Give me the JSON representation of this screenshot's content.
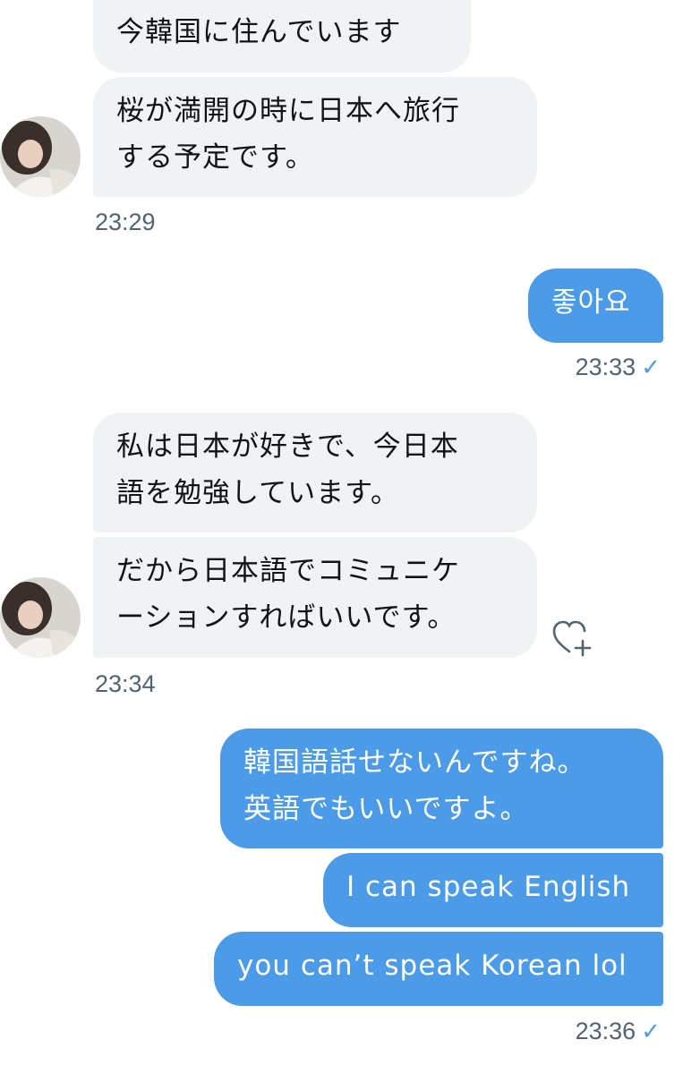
{
  "messages": {
    "m1": "今韓国に住んでいます",
    "m2": "桜が満開の時に日本へ旅行\nする予定です。",
    "t1": "23:29",
    "m3": "좋아요",
    "t2": "23:33",
    "m4": "私は日本が好きで、今日本\n語を勉強しています。",
    "m5": "だから日本語でコミュニケ\nーションすればいいです。",
    "t3": "23:34",
    "m6": "韓国語話せないんですね。\n英語でもいいですよ。",
    "m7": "I can speak English",
    "m8": "you can’t speak Korean lol",
    "t4": "23:36"
  },
  "icons": {
    "read_receipt": "checkmark-icon",
    "react": "heart-plus-icon",
    "avatar": "user-avatar"
  },
  "colors": {
    "incoming_bubble": "#eff3f4",
    "outgoing_bubble": "#4c9be9",
    "timestamp": "#536471"
  }
}
